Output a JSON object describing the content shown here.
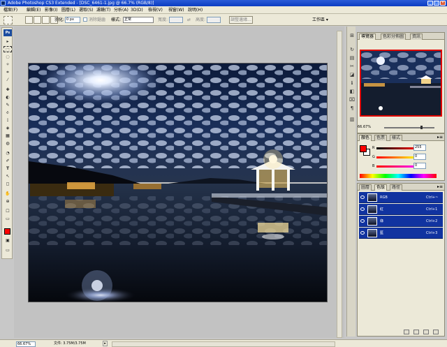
{
  "window": {
    "title": "Adobe Photoshop CS3 Extended - [DSC_6461-1.jpg @ 66.7% (RGB/8)]",
    "controls": {
      "minimize": "_",
      "maximize": "□",
      "close": "×"
    }
  },
  "menu": {
    "items": [
      "檔案(F)",
      "編輯(E)",
      "影像(I)",
      "圖層(L)",
      "選取(S)",
      "濾鏡(T)",
      "分析(A)",
      "3D(D)",
      "檢視(V)",
      "視窗(W)",
      "說明(H)"
    ]
  },
  "options": {
    "feather_label": "羽化:",
    "feather_value": "0 px",
    "antialias_label": "消除鋸齒",
    "style_label": "樣式:",
    "style_value": "正常",
    "width_label": "寬度:",
    "height_label": "高度:",
    "refine_edge_label": "調整邊緣...",
    "workspace_label": "工作區 ▾"
  },
  "tools": {
    "logo": "Ps",
    "glyphs": [
      "▸",
      "⬚",
      "◌",
      "✧",
      "⌗",
      "⁄",
      "✚",
      "◐",
      "✎",
      "⎀",
      "⟟",
      "◈",
      "▦",
      "◍",
      "◔",
      "✐",
      "T",
      "↖",
      "◻",
      "✋",
      "⊕",
      "☐",
      "▭",
      "▣"
    ]
  },
  "dock": {
    "icons": [
      "⊞",
      "↻",
      "▤",
      "✂",
      "◪",
      "ℹ",
      "◧",
      "⌧",
      "¶",
      "▥"
    ]
  },
  "navigator": {
    "tabs": [
      "導覽器",
      "色彩分佈圖",
      "資訊"
    ],
    "zoom": "66.67%"
  },
  "color": {
    "tabs": [
      "顏色",
      "色票",
      "樣式"
    ],
    "fg_color": "#ff0000",
    "bg_color": "#ffffff",
    "channels": [
      {
        "label": "R",
        "value": "255"
      },
      {
        "label": "G",
        "value": "0"
      },
      {
        "label": "B",
        "value": "0"
      }
    ]
  },
  "channels": {
    "tabs": [
      "圖層",
      "色版",
      "路徑"
    ],
    "rows": [
      {
        "name": "RGB",
        "shortcut": "Ctrl+~"
      },
      {
        "name": "紅",
        "shortcut": "Ctrl+1"
      },
      {
        "name": "綠",
        "shortcut": "Ctrl+2"
      },
      {
        "name": "藍",
        "shortcut": "Ctrl+3"
      }
    ]
  },
  "status": {
    "zoom": "66.67%",
    "doc_size": "文件: 3.75M/3.75M"
  },
  "colors": {
    "title_bar": "#0a3cc2",
    "selection": "#1133a0",
    "foreground": "#ff0000"
  }
}
